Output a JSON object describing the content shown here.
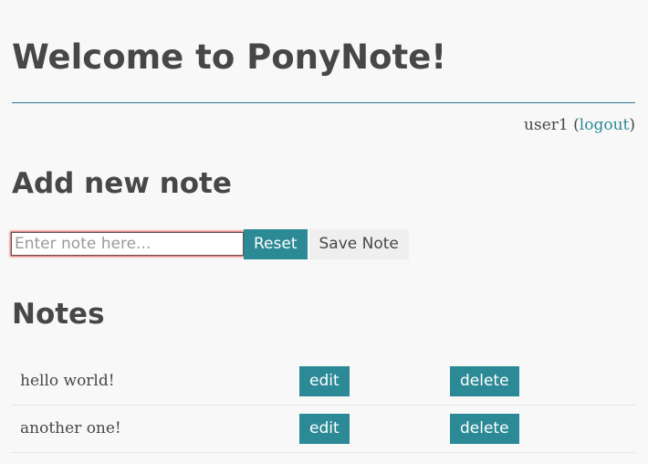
{
  "header": {
    "title": "Welcome to PonyNote!"
  },
  "user_bar": {
    "username": "user1",
    "open_paren": " (",
    "logout_label": "logout",
    "close_paren": ")"
  },
  "add_note": {
    "heading": "Add new note",
    "input_value": "",
    "input_placeholder": "Enter note here...",
    "reset_label": "Reset",
    "save_label": "Save Note"
  },
  "notes": {
    "heading": "Notes",
    "items": [
      {
        "text": "hello world!",
        "edit_label": "edit",
        "delete_label": "delete"
      },
      {
        "text": "another one!",
        "edit_label": "edit",
        "delete_label": "delete"
      }
    ]
  },
  "colors": {
    "accent": "#2b8a95",
    "rule": "#2b7a8c",
    "text": "#474747",
    "background": "#f8f8f8",
    "input_focus_ring": "#e05656"
  }
}
